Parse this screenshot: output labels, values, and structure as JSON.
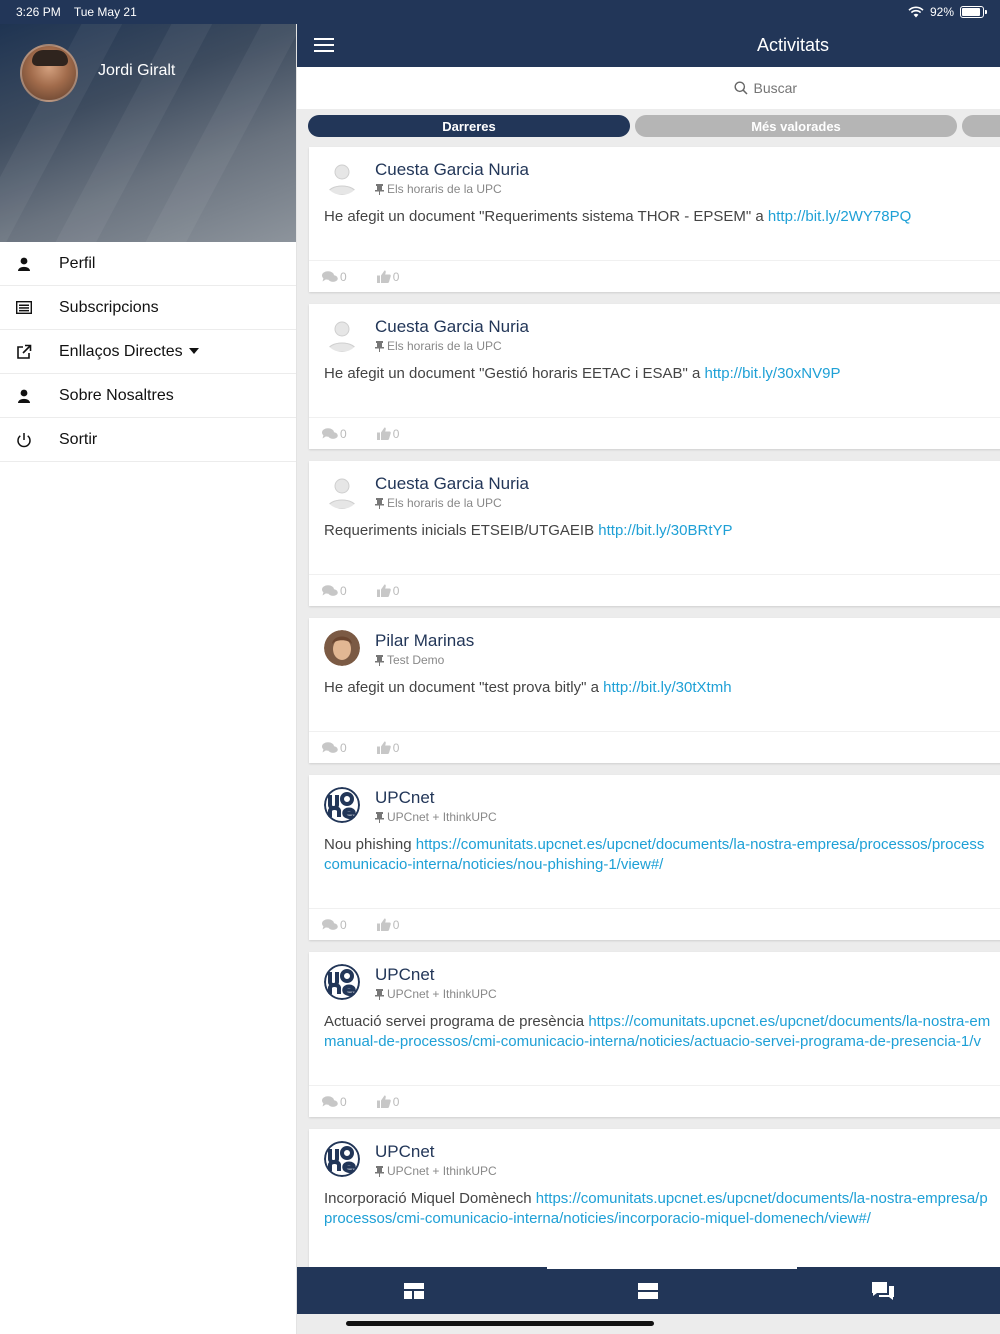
{
  "status_bar": {
    "time": "3:26 PM",
    "date": "Tue May 21",
    "battery": "92%"
  },
  "sidebar": {
    "user_name": "Jordi Giralt",
    "items": [
      {
        "label": "Perfil",
        "icon": "user-icon"
      },
      {
        "label": "Subscripcions",
        "icon": "list-icon"
      },
      {
        "label": "Enllaços Directes",
        "icon": "external-link-icon"
      },
      {
        "label": "Sobre Nosaltres",
        "icon": "user-icon"
      },
      {
        "label": "Sortir",
        "icon": "power-icon"
      }
    ]
  },
  "header": {
    "title": "Activitats"
  },
  "search": {
    "placeholder": "Buscar"
  },
  "tabs": {
    "recent": "Darreres",
    "top_rated": "Més valorades"
  },
  "posts": [
    {
      "author": "Cuesta Garcia Nuria",
      "context": "Els horaris de la UPC",
      "text": "He afegit un document \"Requeriments sistema THOR - EPSEM\" a ",
      "link": "http://bit.ly/2WY78PQ",
      "link2": "",
      "comments": "0",
      "likes": "0"
    },
    {
      "author": "Cuesta Garcia Nuria",
      "context": "Els horaris de la UPC",
      "text": "He afegit un document \"Gestió horaris EETAC i ESAB\" a ",
      "link": "http://bit.ly/30xNV9P",
      "link2": "",
      "comments": "0",
      "likes": "0"
    },
    {
      "author": "Cuesta Garcia Nuria",
      "context": "Els horaris de la UPC",
      "text": "Requeriments inicials ETSEIB/UTGAEIB ",
      "link": "http://bit.ly/30BRtYP",
      "link2": "",
      "comments": "0",
      "likes": "0"
    },
    {
      "author": "Pilar Marinas",
      "context": "Test Demo",
      "text": "He afegit un document \"test prova bitly\" a ",
      "link": "http://bit.ly/30tXtmh",
      "link2": "",
      "comments": "0",
      "likes": "0"
    },
    {
      "author": "UPCnet",
      "context": "UPCnet + IthinkUPC",
      "text": "Nou phishing ",
      "link": "https://comunitats.upcnet.es/upcnet/documents/la-nostra-empresa/processos/process",
      "link2": "comunicacio-interna/noticies/nou-phishing-1/view#/",
      "comments": "0",
      "likes": "0"
    },
    {
      "author": "UPCnet",
      "context": "UPCnet + IthinkUPC",
      "text": "Actuació servei programa de presència ",
      "link": "https://comunitats.upcnet.es/upcnet/documents/la-nostra-em",
      "link2": "manual-de-processos/cmi-comunicacio-interna/noticies/actuacio-servei-programa-de-presencia-1/v",
      "comments": "0",
      "likes": "0"
    },
    {
      "author": "UPCnet",
      "context": "UPCnet + IthinkUPC",
      "text": "Incorporació Miquel Domènech ",
      "link": "https://comunitats.upcnet.es/upcnet/documents/la-nostra-empresa/p",
      "link2": "processos/cmi-comunicacio-interna/noticies/incorporacio-miquel-domenech/view#/",
      "comments": "",
      "likes": ""
    }
  ],
  "colors": {
    "brand": "#223658",
    "link": "#1ea0d6",
    "inactive_tab": "#b5b5b5"
  }
}
